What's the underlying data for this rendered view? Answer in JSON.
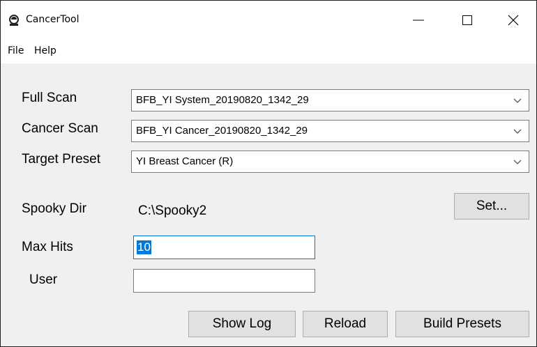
{
  "window": {
    "title": "CancerTool"
  },
  "menu": {
    "items": [
      {
        "label": "File"
      },
      {
        "label": "Help"
      }
    ]
  },
  "form": {
    "full_scan": {
      "label": "Full Scan",
      "value": "BFB_YI System_20190820_1342_29"
    },
    "cancer_scan": {
      "label": "Cancer Scan",
      "value": "BFB_YI Cancer_20190820_1342_29"
    },
    "target_preset": {
      "label": "Target Preset",
      "value": "YI Breast Cancer (R)"
    },
    "spooky_dir": {
      "label": "Spooky Dir",
      "value": "C:\\Spooky2"
    },
    "max_hits": {
      "label": "Max Hits",
      "value": "10"
    },
    "user": {
      "label": "User",
      "value": ""
    }
  },
  "buttons": {
    "set": "Set...",
    "show_log": "Show Log",
    "reload": "Reload",
    "build_presets": "Build Presets"
  },
  "colors": {
    "selection": "#0078d7",
    "focus_border": "#0078d7",
    "button_face": "#e1e1e1"
  }
}
